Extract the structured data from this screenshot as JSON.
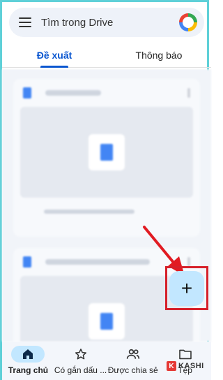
{
  "search": {
    "placeholder": "Tìm trong Drive"
  },
  "tabs": [
    {
      "label": "Đề xuất",
      "active": true
    },
    {
      "label": "Thông báo",
      "active": false
    }
  ],
  "fab": {
    "label": "+"
  },
  "bottom_nav": [
    {
      "label": "Trang chủ",
      "icon": "home-icon",
      "active": true
    },
    {
      "label": "Có gắn dấu ...",
      "icon": "star-icon",
      "active": false
    },
    {
      "label": "Được chia sẻ",
      "icon": "people-icon",
      "active": false
    },
    {
      "label": "Tệp",
      "icon": "folder-icon",
      "active": false
    }
  ],
  "watermark": {
    "letter": "K",
    "text": "KASHI"
  },
  "colors": {
    "accent": "#0b57d0",
    "fab": "#c2e7ff",
    "highlight": "#d6202a",
    "frame": "#5fd0d8"
  }
}
